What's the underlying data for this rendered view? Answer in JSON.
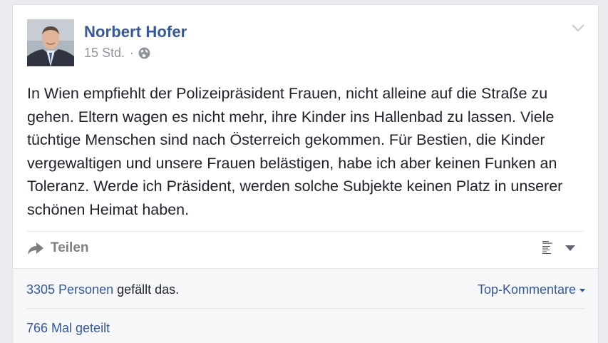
{
  "post": {
    "author": "Norbert Hofer",
    "timestamp": "15 Std.",
    "separator": "·",
    "audience_icon": "globe-icon",
    "text": "In Wien empfiehlt der Polizeipräsident Frauen, nicht alleine auf die Straße zu gehen. Eltern wagen es nicht mehr, ihre Kinder ins Hallenbad zu lassen. Viele tüchtige Menschen sind nach Österreich gekommen. Für Bestien, die Kinder vergewaltigen und unsere Frauen belästigen, habe ich aber keinen Funken an Toleranz. Werde ich Präsident, werden solche Subjekte keinen Platz in unserer schönen Heimat haben."
  },
  "actions": {
    "share_label": "Teilen",
    "share_icon": "share-arrow-icon",
    "menu_icon": "chevron-down-icon"
  },
  "footer": {
    "likes_link": "3305 Personen",
    "likes_suffix": " gefällt das.",
    "top_comments_label": "Top-Kommentare",
    "shares_label": "766 Mal geteilt"
  },
  "colors": {
    "link_blue": "#365899",
    "text": "#1d2129",
    "muted": "#90949c",
    "footer_bg": "#f6f7f9",
    "page_bg": "#e9ebee"
  }
}
